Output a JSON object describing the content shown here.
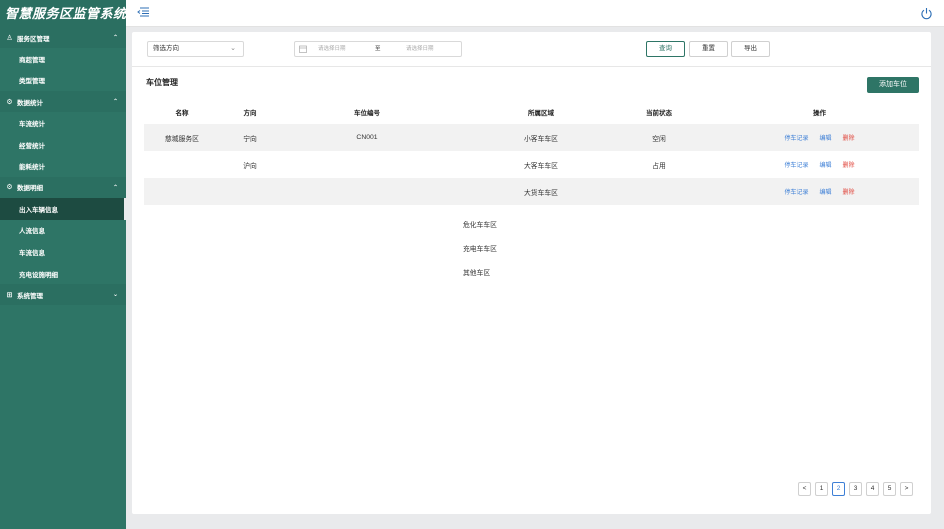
{
  "sidebar": {
    "brand": "智慧服务区监管系统",
    "groups": [
      {
        "label": "服务区管理",
        "icon": "user-icon",
        "chevron": "⌃",
        "items": [
          "商超管理",
          "类型管理"
        ]
      },
      {
        "label": "数据统计",
        "icon": "settings-icon",
        "chevron": "⌃",
        "items": [
          "车流统计",
          "经营统计",
          "能耗统计"
        ]
      },
      {
        "label": "数据明细",
        "icon": "settings-icon",
        "chevron": "⌃",
        "items": [
          "出入车辆信息",
          "人流信息",
          "车流信息",
          "充电设施明细"
        ],
        "active_index": 0
      },
      {
        "label": "系统管理",
        "icon": "grid-icon",
        "chevron": "⌄",
        "items": []
      }
    ]
  },
  "filters": {
    "direction_select": "筛选方向",
    "date_start_placeholder": "请选择日期",
    "date_separator": "至",
    "date_end_placeholder": "请选择日期",
    "query_label": "查询",
    "reset_label": "重置",
    "export_label": "导出"
  },
  "section": {
    "title": "车位管理",
    "add_label": "添加车位"
  },
  "table": {
    "headers": [
      "名称",
      "方向",
      "车位编号",
      "所属区域",
      "当前状态",
      "操作"
    ],
    "rows": [
      {
        "name": "慈城服务区",
        "direction": "宁向",
        "code": "CN001",
        "area": "小客车车区",
        "status": "空闲"
      },
      {
        "name": "",
        "direction": "沪向",
        "code": "",
        "area": "大客车车区",
        "status": "占用"
      },
      {
        "name": "",
        "direction": "",
        "code": "",
        "area": "大货车车区",
        "status": ""
      }
    ],
    "ops": {
      "record": "停车记录",
      "edit": "编辑",
      "delete": "删除"
    },
    "extra_areas": [
      "危化车车区",
      "充电车车区",
      "其他车区"
    ]
  },
  "pagination": {
    "prev": "<",
    "pages": [
      "1",
      "2",
      "3",
      "4",
      "5"
    ],
    "active": "2",
    "next": ">"
  },
  "colors": {
    "brand": "#2e7566",
    "sidebar_active": "#1d4b41",
    "link": "#3d7fd6",
    "danger": "#e0453b"
  }
}
